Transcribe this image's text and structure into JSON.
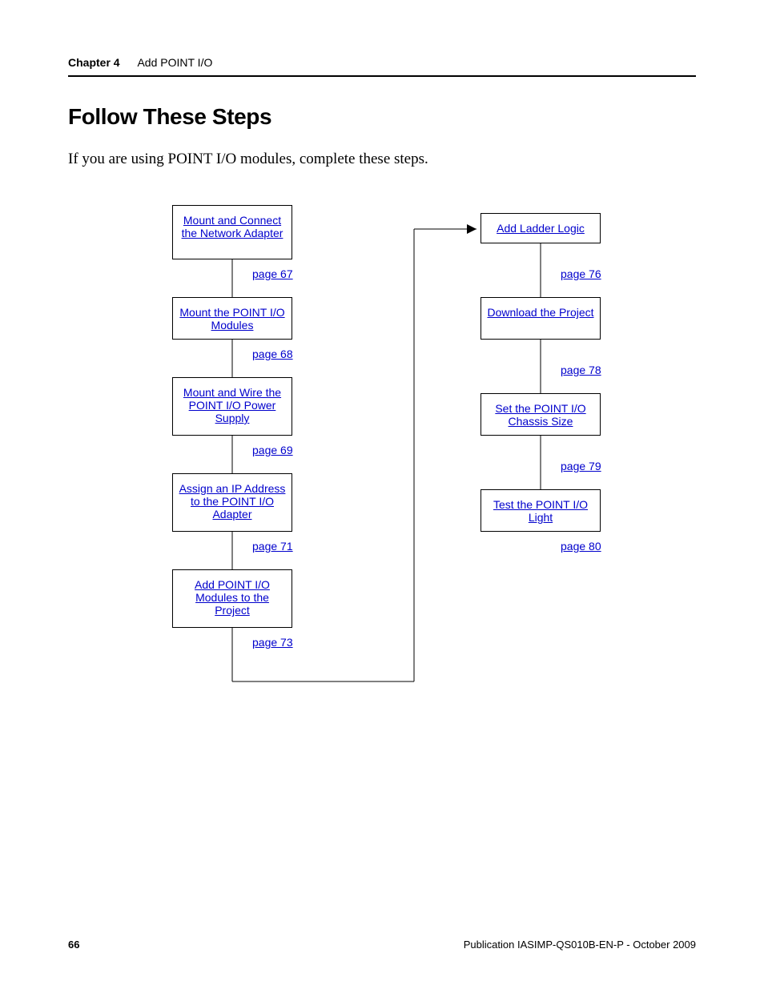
{
  "header": {
    "chapter": "Chapter 4",
    "title": "Add POINT I/O"
  },
  "heading": "Follow These Steps",
  "intro": "If you are using POINT I/O modules, complete these steps.",
  "left_steps": [
    {
      "label": "Mount and Connect the Network Adapter",
      "page": "page 67"
    },
    {
      "label": "Mount the POINT I/O Modules",
      "page": "page 68"
    },
    {
      "label": "Mount and Wire the POINT I/O Power Supply",
      "page": "page 69"
    },
    {
      "label": "Assign an IP Address to the POINT I/O Adapter",
      "page": "page 71"
    },
    {
      "label": "Add POINT I/O Modules to the Project",
      "page": "page 73"
    }
  ],
  "right_steps": [
    {
      "label": "Add Ladder Logic",
      "page": "page 76"
    },
    {
      "label": "Download the Project",
      "page": "page 78"
    },
    {
      "label": "Set the POINT I/O Chassis Size",
      "page": "page 79"
    },
    {
      "label": "Test the POINT I/O Light",
      "page": "page 80"
    }
  ],
  "footer": {
    "page_number": "66",
    "publication": "Publication IASIMP-QS010B-EN-P - October 2009"
  }
}
